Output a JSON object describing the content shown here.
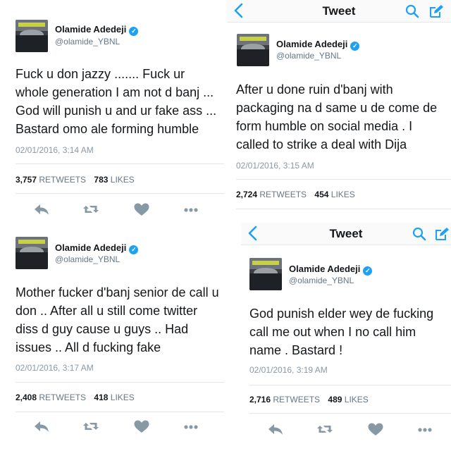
{
  "user": {
    "name": "Olamide Adedeji",
    "handle": "@olamide_YBNL"
  },
  "nav": {
    "title": "Tweet"
  },
  "tweets": [
    {
      "text": "Fuck u don jazzy ....... Fuck ur whole generation I am not d banj ... God will punish u and ur fake ass ... Bastard omo ale forming humble",
      "time": "02/01/2016, 3:14 AM",
      "retweets": "3,757",
      "retweets_label": "RETWEETS",
      "likes": "783",
      "likes_label": "LIKES"
    },
    {
      "text": "After u done ruin d'banj with packaging na d same u de come de form humble on social media . I called to strike a deal with Dija",
      "time": "02/01/2016, 3:15 AM",
      "retweets": "2,724",
      "retweets_label": "RETWEETS",
      "likes": "454",
      "likes_label": "LIKES"
    },
    {
      "text": "Mother fucker d'banj senior de call u don .. After all u still come twitter diss d guy cause u guys .. Had issues .. All d fucking fake",
      "time": "02/01/2016, 3:17 AM",
      "retweets": "2,408",
      "retweets_label": "RETWEETS",
      "likes": "418",
      "likes_label": "LIKES"
    },
    {
      "text": "God punish elder wey de fucking call me out when I no call him name . Bastard !",
      "time": "02/01/2016, 3:19 AM",
      "retweets": "2,716",
      "retweets_label": "RETWEETS",
      "likes": "489",
      "likes_label": "LIKES"
    }
  ],
  "icons": {
    "back": "chevron-left-icon",
    "search": "search-icon",
    "compose": "compose-icon",
    "reply": "reply-icon",
    "retweet": "retweet-icon",
    "like": "heart-icon",
    "more": "more-icon"
  },
  "colors": {
    "accent": "#1da1f2",
    "icon_gray": "#8899a6",
    "text": "#14171a",
    "secondary": "#657786"
  }
}
